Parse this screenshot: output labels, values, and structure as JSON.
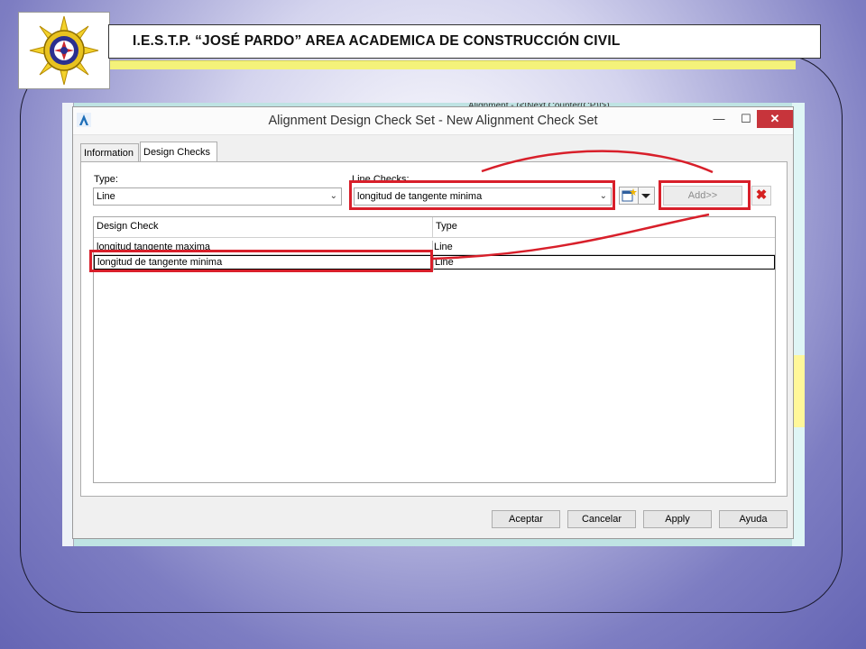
{
  "slide": {
    "title": "I.E.S.T.P. “JOSÉ PARDO” AREA ACADEMICA DE CONSTRUCCIÓN CIVIL"
  },
  "backdrop": {
    "top_text": "Alignment - (<[Next Counter(CP)]>)"
  },
  "dialog": {
    "title": "Alignment Design Check Set - New Alignment Check Set",
    "tabs": [
      "Information",
      "Design Checks"
    ],
    "type_label": "Type:",
    "type_value": "Line",
    "line_checks_label": "Line Checks:",
    "line_checks_value": "longitud de tangente minima",
    "add_label": "Add>>",
    "grid": {
      "headers": [
        "Design Check",
        "Type"
      ],
      "rows": [
        {
          "check": "longitud tangente maxima",
          "type": "Line"
        },
        {
          "check": "longitud de tangente minima",
          "type": "Line"
        }
      ]
    },
    "buttons": {
      "ok": "Aceptar",
      "cancel": "Cancelar",
      "apply": "Apply",
      "help": "Ayuda"
    },
    "window_controls": {
      "minimize": "—",
      "maximize": "☐",
      "close": "✕"
    }
  },
  "colors": {
    "highlight": "#d81f2a",
    "slide_background": "#7d7dc2",
    "title_strip": "#f4f27a"
  }
}
